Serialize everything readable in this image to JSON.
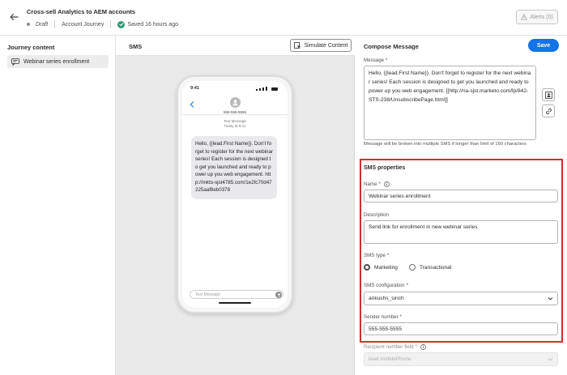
{
  "header": {
    "title": "Cross-sell Analytics to AEM accounts",
    "status": "Draft",
    "journey_type": "Account Journey",
    "saved": "Saved 16 hours ago",
    "alerts_label": "Alerts (0)"
  },
  "left": {
    "title": "Journey content",
    "items": [
      {
        "label": "Webinar series enrollment"
      }
    ]
  },
  "middle": {
    "title": "SMS",
    "simulate_label": "Simulate Content",
    "phone": {
      "time": "9:41",
      "contact": "555-555-5555",
      "meta_line1": "Text Message",
      "meta_line2": "Today at 9:41",
      "message": "Hello, {{lead.First Name}}. Don't forget to register for the next webinar series! Each session is designed to get you launched and ready to power up you web engagement.  http://mkto-sjst4785.com/1e2fc70d47225aaf8eb0378",
      "input_placeholder": "Text Message"
    }
  },
  "right": {
    "title": "Compose Message",
    "save_label": "Save",
    "message_label": "Message",
    "required_mark": "*",
    "message_value": "Hello, {{lead.First Name}}. Don't forget to register for the next webinar series! Each session is designed to get you launched and ready to power up you web engagement.  [[http://na-sjst.marketo.com/lp/842-STS-238/UnsubscribePage.html]]",
    "helper_text": "Message will be broken into multiple SMS if longer than limit of 160 characters",
    "sms_properties": {
      "title": "SMS properties",
      "name_label": "Name",
      "name_value": "Webinar series enrollment",
      "description_label": "Description",
      "description_value": "Send link for enrollment in new webinar series",
      "type_label": "SMS type",
      "type_options": [
        "Marketing",
        "Transactional"
      ],
      "config_label": "SMS configuration",
      "config_value": "ankushs_sinch",
      "sender_label": "Sender number",
      "sender_value": "555-555-5555"
    },
    "recipient_label": "Recipient number field",
    "recipient_value": "lead.mobilePhone"
  },
  "colors": {
    "accent": "#1473e6",
    "highlight_border": "#d32f2f",
    "success": "#2d9d78"
  }
}
